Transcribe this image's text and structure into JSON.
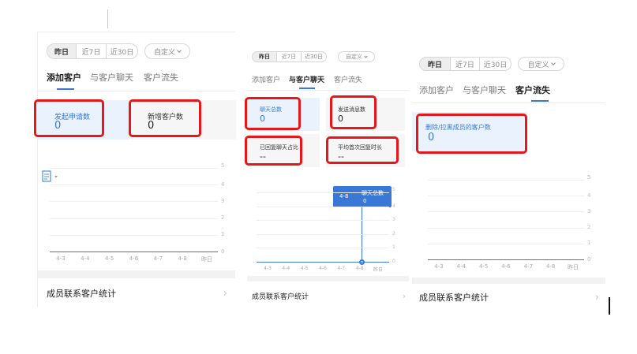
{
  "filters": {
    "yesterday": "昨日",
    "last7": "近7日",
    "last30": "近30日",
    "custom": "自定义"
  },
  "tabs": {
    "add": "添加客户",
    "chat": "与客户聊天",
    "lost": "客户流失"
  },
  "panel1": {
    "cards": [
      {
        "label": "发起申请数",
        "value": "0"
      },
      {
        "label": "新增客户数",
        "value": "0"
      }
    ],
    "y_ticks": [
      "5",
      "4",
      "3",
      "2",
      "1",
      "0"
    ],
    "x_ticks": [
      "4-3",
      "4-4",
      "4-5",
      "4-6",
      "4-7",
      "4-8",
      "昨日"
    ],
    "footer": "成员联系客户统计"
  },
  "panel2": {
    "cards": [
      {
        "label": "聊天总数",
        "value": "0"
      },
      {
        "label": "发送消息数",
        "value": "0"
      },
      {
        "label": "已回复聊天占比",
        "value": "--"
      },
      {
        "label": "平均首次回复时长",
        "value": "--"
      }
    ],
    "tooltip": {
      "date": "4-8",
      "series": "聊天总数",
      "value": "0"
    },
    "y_ticks": [
      "5",
      "4",
      "3",
      "2",
      "1",
      "0"
    ],
    "x_ticks": [
      "4-3",
      "4-4",
      "4-5",
      "4-6",
      "4-7",
      "4-8",
      "昨日"
    ],
    "footer": "成员联系客户统计"
  },
  "panel3": {
    "cards": [
      {
        "label": "删除/拉黑成员的客户数",
        "value": "0"
      }
    ],
    "y_ticks": [
      "5",
      "4",
      "3",
      "2",
      "1",
      "0"
    ],
    "x_ticks": [
      "4-3",
      "4-4",
      "4-5",
      "4-6",
      "4-7",
      "4-8",
      "昨日"
    ],
    "footer": "成员联系客户统计"
  },
  "colors": {
    "accent": "#3a78d8",
    "highlight_box": "#e5171b",
    "selected_card_bg": "#e9f2fd"
  }
}
